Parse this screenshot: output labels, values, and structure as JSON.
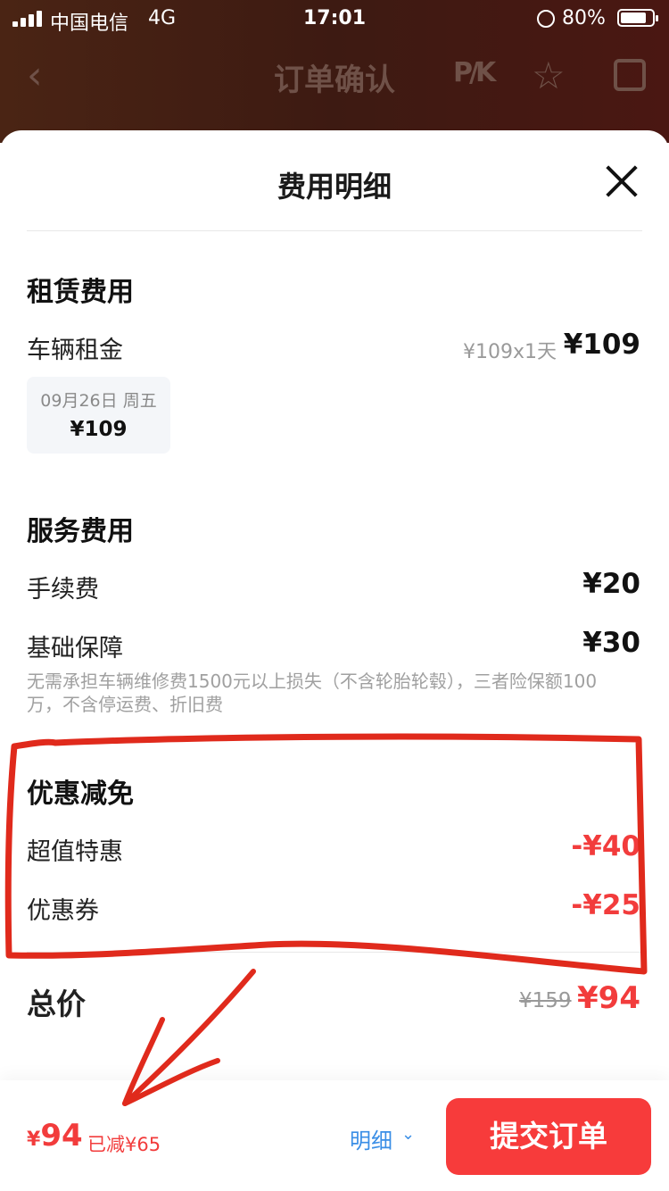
{
  "status_bar": {
    "carrier": "中国电信",
    "network": "4G",
    "time": "17:01",
    "battery": "80%"
  },
  "nav": {
    "back": "‹",
    "title": "订单确认",
    "pk_label": "P/K",
    "star_icon": "star-icon",
    "share_icon": "share-icon"
  },
  "sheet": {
    "title": "费用明细",
    "rental": {
      "title": "租赁费用",
      "row_label": "车辆租金",
      "unit_price": "¥109x1天",
      "amount": "¥109",
      "date_card": {
        "date": "09月26日 周五",
        "price": "¥109"
      }
    },
    "service": {
      "title": "服务费用",
      "rows": [
        {
          "label": "手续费",
          "amount": "¥20"
        },
        {
          "label": "基础保障",
          "amount": "¥30"
        }
      ],
      "note": "无需承担车辆维修费1500元以上损失（不含轮胎轮毂），三者险保额100万，不含停运费、折旧费"
    },
    "discount": {
      "title": "优惠减免",
      "rows": [
        {
          "label": "超值特惠",
          "amount": "-¥40"
        },
        {
          "label": "优惠券",
          "amount": "-¥25"
        }
      ]
    },
    "total": {
      "label": "总价",
      "original": "¥159",
      "final": "¥94"
    }
  },
  "bottom_bar": {
    "currency": "¥",
    "price": "94",
    "saved": "已减¥65",
    "detail_label": "明细",
    "submit_label": "提交订单"
  },
  "colors": {
    "accent_red": "#f23c3c",
    "button_red": "#f73b3b",
    "link_blue": "#3a8ee6",
    "highlight_pink": "#fbc8c8",
    "annotation_red": "#e02a1c"
  }
}
